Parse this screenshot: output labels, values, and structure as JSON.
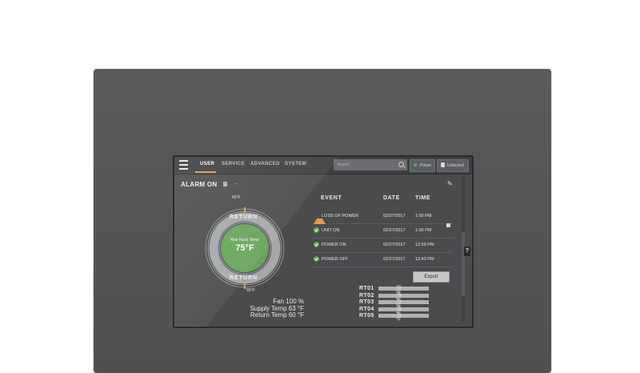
{
  "nav": {
    "tabs": [
      {
        "label": "USER",
        "active": true
      },
      {
        "label": "SERVICE",
        "active": false
      },
      {
        "label": "ADVANCED",
        "active": false
      },
      {
        "label": "SYSTEM",
        "active": false
      }
    ],
    "search_placeholder": "Search",
    "power_label": "Power",
    "lock_label": "Unlocked"
  },
  "alarm": {
    "label": "ALARM ON",
    "dash": "-"
  },
  "dial": {
    "top_setpoint": "65°F",
    "bottom_setpoint": "65°F",
    "ring_label_top": "RETURN",
    "ring_label_bottom": "RETURN",
    "center_label": "Max Rack Temp",
    "center_value": "75°F"
  },
  "readouts": {
    "fan": "Fan 100 %",
    "supply": "Supply Temp 63 °F",
    "return": "Return Temp 60 °F"
  },
  "events": {
    "headers": {
      "event": "EVENT",
      "date": "DATE",
      "time": "TIME"
    },
    "rows": [
      {
        "status": "warning",
        "name": "LOSS OF POWER",
        "date": "02/27/2017",
        "time": "1:00 PM"
      },
      {
        "status": "ok",
        "name": "UNIT ON",
        "date": "02/27/2017",
        "time": "1:00 PM"
      },
      {
        "status": "ok",
        "name": "POWER ON",
        "date": "02/27/2017",
        "time": "12:59 PM"
      },
      {
        "status": "ok",
        "name": "POWER OFF",
        "date": "02/27/2017",
        "time": "12:43 PM"
      }
    ],
    "export_label": "Export",
    "help_label": "?"
  },
  "rack_temps": [
    {
      "label": "RT01",
      "value": "75 °F"
    },
    {
      "label": "RT02",
      "value": "75 °F"
    },
    {
      "label": "RT03",
      "value": "75 °F"
    },
    {
      "label": "RT04",
      "value": "75 °F"
    },
    {
      "label": "RT05",
      "value": "75 °F"
    }
  ],
  "colors": {
    "accent": "#e39a4a",
    "ok": "#5fa84a",
    "dial_center": "#67a45a",
    "bezel": "#555658",
    "screen_bg": "#4a4b4d"
  }
}
